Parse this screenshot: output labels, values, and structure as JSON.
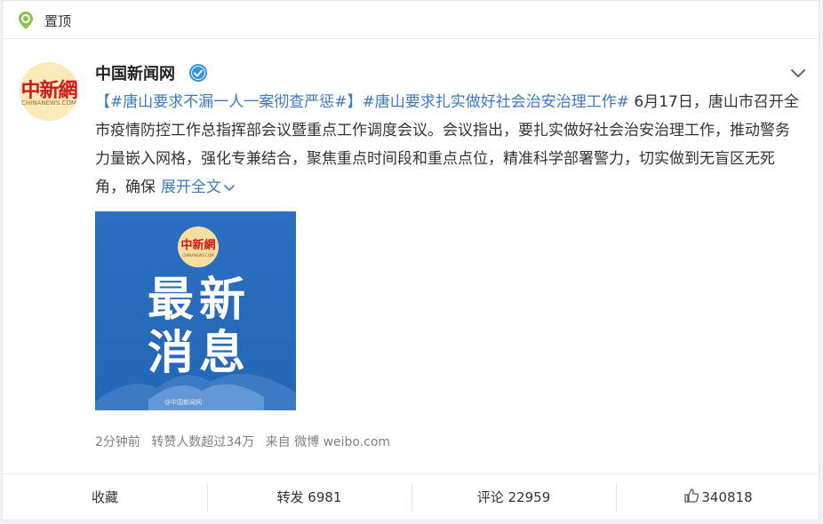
{
  "pinned": {
    "label": "置顶"
  },
  "post": {
    "author": "中国新闻网",
    "avatar_logo": "中新網",
    "avatar_logo_en": "CHINANEWS.COM",
    "tag1": "【#唐山要求不漏一人一案彻查严惩#】",
    "tag2": "#唐山要求扎实做好社会治安治理工作#",
    "body": " 6月17日，唐山市召开全市疫情防控工作总指挥部会议暨重点工作调度会议。会议指出，要扎实做好社会治安治理工作，推动警务力量嵌入网格，强化专兼结合，聚焦重点时间段和重点点位，精准科学部署警力，切实做到无盲区无死角，确保",
    "expand_label": "展开全文",
    "image": {
      "logo": "中新網",
      "logo_en": "CHINANEWS.COM",
      "line1": "最新",
      "line2": "消息",
      "watermark": "@中国新闻网"
    },
    "meta": {
      "time": "2分钟前",
      "stat": "转赞人数超过34万",
      "source": "来自 微博 weibo.com"
    }
  },
  "actions": {
    "favorite": "收藏",
    "repost": "转发 6981",
    "comment": "评论 22959",
    "like": "340818"
  },
  "colors": {
    "link": "#3a7ac4",
    "pin_green": "#8bc34a",
    "verified_blue": "#2f91e8",
    "image_blue": "#2466b6"
  }
}
